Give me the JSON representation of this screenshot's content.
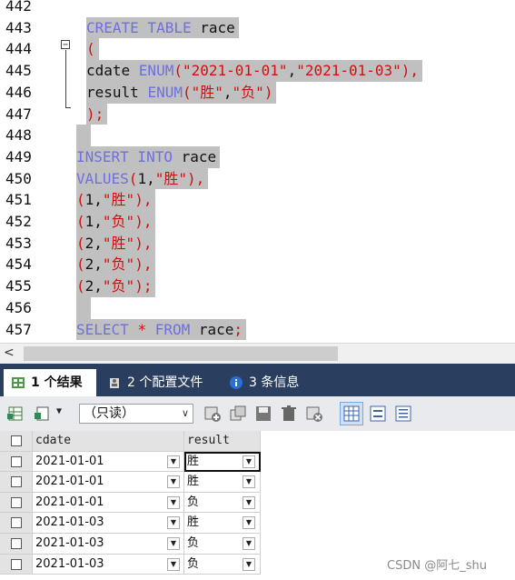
{
  "editor": {
    "lines": [
      {
        "num": "442",
        "tokens": []
      },
      {
        "num": "443",
        "tokens": [
          {
            "t": "CREATE TABLE",
            "c": "kw"
          },
          {
            "t": " race",
            "c": "pl"
          }
        ]
      },
      {
        "num": "444",
        "tokens": [
          {
            "t": "(",
            "c": "str"
          }
        ]
      },
      {
        "num": "445",
        "tokens": [
          {
            "t": "cdate ",
            "c": "pl"
          },
          {
            "t": "ENUM",
            "c": "fn"
          },
          {
            "t": "(",
            "c": "str"
          },
          {
            "t": "\"2021-01-01\"",
            "c": "str"
          },
          {
            "t": ",",
            "c": "pl"
          },
          {
            "t": "\"2021-01-03\"",
            "c": "str"
          },
          {
            "t": "),",
            "c": "str"
          }
        ]
      },
      {
        "num": "446",
        "tokens": [
          {
            "t": "result ",
            "c": "pl"
          },
          {
            "t": "ENUM",
            "c": "fn"
          },
          {
            "t": "(",
            "c": "str"
          },
          {
            "t": "\"胜\"",
            "c": "str"
          },
          {
            "t": ",",
            "c": "pl"
          },
          {
            "t": "\"负\"",
            "c": "str"
          },
          {
            "t": ")",
            "c": "str"
          }
        ]
      },
      {
        "num": "447",
        "tokens": [
          {
            "t": ");",
            "c": "str"
          }
        ]
      },
      {
        "num": "448",
        "tokens": []
      },
      {
        "num": "449",
        "tokens": [
          {
            "t": "INSERT INTO",
            "c": "kw"
          },
          {
            "t": " race",
            "c": "pl"
          }
        ]
      },
      {
        "num": "450",
        "tokens": [
          {
            "t": "VALUES",
            "c": "kw"
          },
          {
            "t": "(",
            "c": "str"
          },
          {
            "t": "1,",
            "c": "pl"
          },
          {
            "t": "\"胜\"",
            "c": "str"
          },
          {
            "t": "),",
            "c": "str"
          }
        ]
      },
      {
        "num": "451",
        "tokens": [
          {
            "t": "(",
            "c": "str"
          },
          {
            "t": "1,",
            "c": "pl"
          },
          {
            "t": "\"胜\"",
            "c": "str"
          },
          {
            "t": "),",
            "c": "str"
          }
        ]
      },
      {
        "num": "452",
        "tokens": [
          {
            "t": "(",
            "c": "str"
          },
          {
            "t": "1,",
            "c": "pl"
          },
          {
            "t": "\"负\"",
            "c": "str"
          },
          {
            "t": "),",
            "c": "str"
          }
        ]
      },
      {
        "num": "453",
        "tokens": [
          {
            "t": "(",
            "c": "str"
          },
          {
            "t": "2,",
            "c": "pl"
          },
          {
            "t": "\"胜\"",
            "c": "str"
          },
          {
            "t": "),",
            "c": "str"
          }
        ]
      },
      {
        "num": "454",
        "tokens": [
          {
            "t": "(",
            "c": "str"
          },
          {
            "t": "2,",
            "c": "pl"
          },
          {
            "t": "\"负\"",
            "c": "str"
          },
          {
            "t": "),",
            "c": "str"
          }
        ]
      },
      {
        "num": "455",
        "tokens": [
          {
            "t": "(",
            "c": "str"
          },
          {
            "t": "2,",
            "c": "pl"
          },
          {
            "t": "\"负\"",
            "c": "str"
          },
          {
            "t": ");",
            "c": "str"
          }
        ]
      },
      {
        "num": "456",
        "tokens": []
      },
      {
        "num": "457",
        "tokens": [
          {
            "t": "SELECT",
            "c": "kw"
          },
          {
            "t": " ",
            "c": "pl"
          },
          {
            "t": "*",
            "c": "str"
          },
          {
            "t": " ",
            "c": "pl"
          },
          {
            "t": "FROM",
            "c": "kw"
          },
          {
            "t": " race",
            "c": "pl"
          },
          {
            "t": ";",
            "c": "str"
          }
        ]
      }
    ]
  },
  "scrollbar": {
    "left_arrow": "<"
  },
  "tabs": [
    {
      "label": "1 个结果",
      "icon": "result-grid-icon",
      "active": true
    },
    {
      "label": "2 个配置文件",
      "icon": "profile-icon",
      "active": false
    },
    {
      "label": "3 条信息",
      "icon": "info-icon",
      "active": false
    }
  ],
  "toolbar": {
    "mode_select": "（只读）"
  },
  "grid": {
    "columns": [
      "cdate",
      "result"
    ],
    "rows": [
      [
        "2021-01-01",
        "胜"
      ],
      [
        "2021-01-01",
        "胜"
      ],
      [
        "2021-01-01",
        "负"
      ],
      [
        "2021-01-03",
        "胜"
      ],
      [
        "2021-01-03",
        "负"
      ],
      [
        "2021-01-03",
        "负"
      ]
    ]
  },
  "watermark": "CSDN @阿七_shu",
  "colors": {
    "keyword": "#6f6fe0",
    "string": "#cc1111",
    "selection": "#c0c0c0",
    "tab_bar": "#2a3f5f"
  }
}
